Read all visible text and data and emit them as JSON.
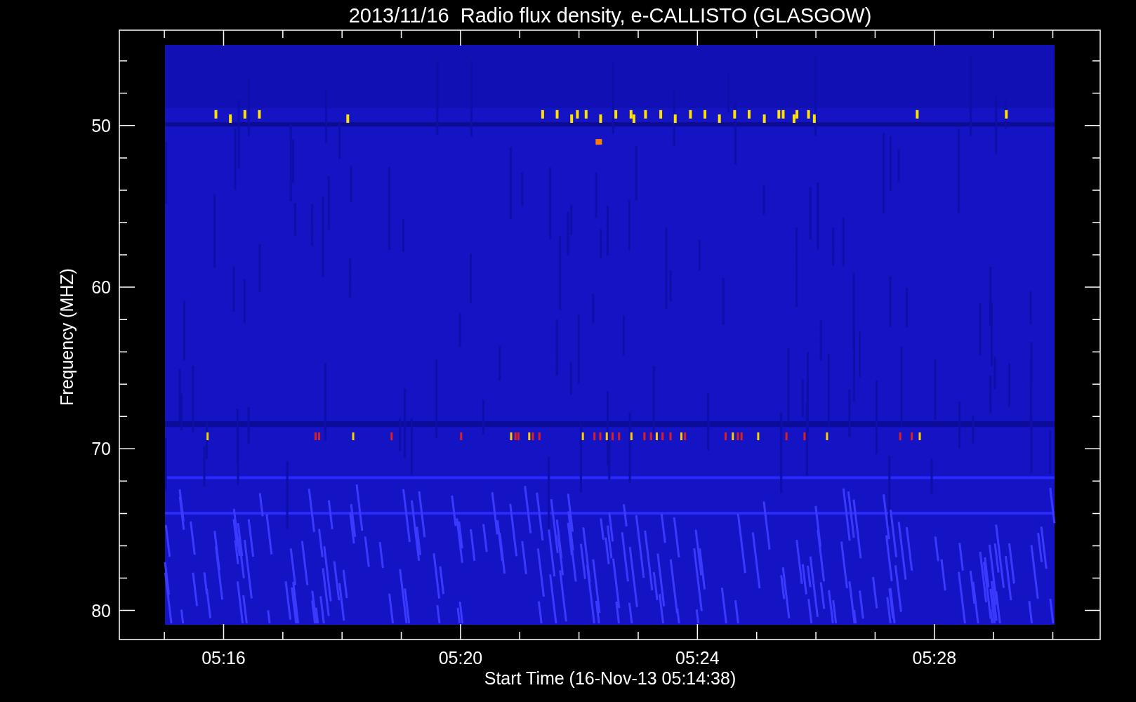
{
  "title": "2013/11/16  Radio flux density, e-CALLISTO (GLASGOW)",
  "y_axis": {
    "label": "Frequency (MHZ)",
    "ticks": [
      "50",
      "60",
      "70",
      "80"
    ]
  },
  "x_axis": {
    "label": "Start Time (16-Nov-13 05:14:38)",
    "ticks": [
      "05:16",
      "05:20",
      "05:24",
      "05:28"
    ]
  }
}
